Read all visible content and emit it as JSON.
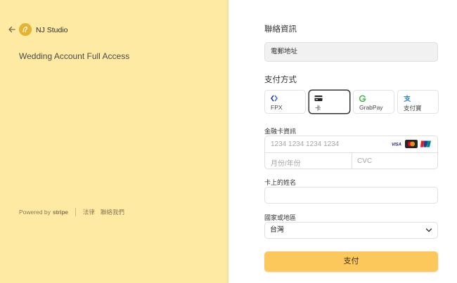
{
  "merchant": {
    "name": "NJ Studio",
    "product": "Wedding Account Full Access",
    "back_icon": "arrow-left-icon",
    "logo_icon": "studio-logo"
  },
  "footer": {
    "powered_by": "Powered by",
    "stripe": "stripe",
    "links": [
      "法律",
      "聯絡我們"
    ]
  },
  "contact": {
    "heading": "聯絡資訊",
    "email_placeholder": "電郵地址"
  },
  "payment": {
    "heading": "支付方式",
    "methods": [
      {
        "label": "FPX",
        "icon": "fpx-icon"
      },
      {
        "label": "卡",
        "icon": "credit-card-icon",
        "selected": true
      },
      {
        "label": "GrabPay",
        "icon": "grabpay-icon"
      },
      {
        "label": "支付寶",
        "icon": "alipay-icon"
      }
    ]
  },
  "card": {
    "label": "金融卡資訊",
    "number_placeholder": "1234 1234 1234 1234",
    "expiry_placeholder": "月份/年份",
    "cvc_placeholder": "CVC",
    "brands": [
      "visa",
      "mastercard",
      "unionpay"
    ]
  },
  "name_on_card": {
    "label": "卡上的姓名"
  },
  "country": {
    "label": "國家或地區",
    "value": "台灣"
  },
  "submit": {
    "label": "支付"
  },
  "colors": {
    "left_bg": "#feeaa3",
    "button": "#fdc85b"
  }
}
